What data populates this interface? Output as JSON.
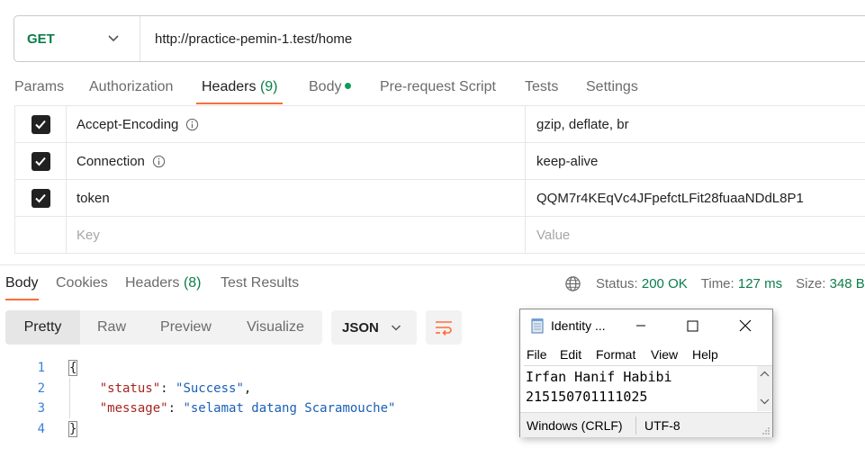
{
  "request": {
    "method": "GET",
    "url": "http://practice-pemin-1.test/home"
  },
  "request_tabs": {
    "params": "Params",
    "authorization": "Authorization",
    "headers": "Headers",
    "headers_count": "(9)",
    "body": "Body",
    "prerequest": "Pre-request Script",
    "tests": "Tests",
    "settings": "Settings"
  },
  "headers_table": {
    "rows": [
      {
        "key": "Accept-Encoding",
        "value": "gzip, deflate, br",
        "checked": true
      },
      {
        "key": "Connection",
        "value": "keep-alive",
        "checked": true
      },
      {
        "key": "token",
        "value": "QQM7r4KEqVc4JFpefctLFit28fuaaNDdL8P1",
        "checked": true
      }
    ],
    "key_placeholder": "Key",
    "value_placeholder": "Value"
  },
  "response_tabs": {
    "body": "Body",
    "cookies": "Cookies",
    "headers": "Headers",
    "headers_count": "(8)",
    "test_results": "Test Results"
  },
  "response_status": {
    "status_label": "Status:",
    "status_value": "200 OK",
    "time_label": "Time:",
    "time_value": "127 ms",
    "size_label": "Size:",
    "size_value": "348 B"
  },
  "view_modes": {
    "pretty": "Pretty",
    "raw": "Raw",
    "preview": "Preview",
    "visualize": "Visualize",
    "format": "JSON"
  },
  "code": {
    "line_numbers": [
      "1",
      "2",
      "3",
      "4"
    ],
    "open_brace": "{",
    "status_key": "\"status\"",
    "status_value": "\"Success\"",
    "message_key": "\"message\"",
    "message_value": "\"selamat datang Scaramouche\"",
    "close_brace": "}"
  },
  "notepad": {
    "title": "Identity ...",
    "menu": {
      "file": "File",
      "edit": "Edit",
      "format": "Format",
      "view": "View",
      "help": "Help"
    },
    "content_line1": "Irfan Hanif Habibi",
    "content_line2": "215150701111025",
    "line_ending": "Windows (CRLF)",
    "encoding": "UTF-8"
  },
  "colors": {
    "accent": "#ff6c37",
    "success": "#0c7d4a"
  }
}
